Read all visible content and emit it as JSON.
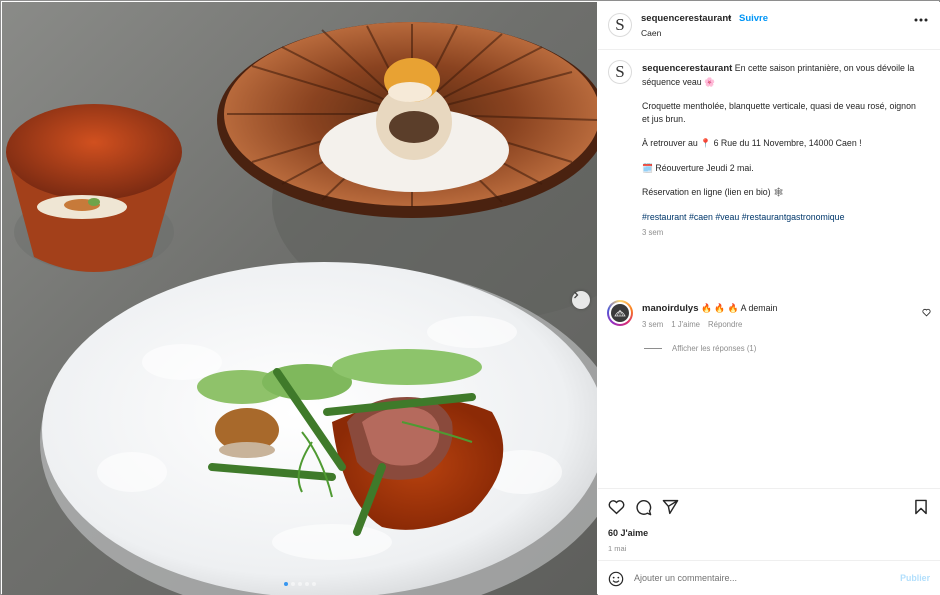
{
  "post": {
    "username": "sequencerestaurant",
    "separator": "•",
    "follow_label": "Suivre",
    "location": "Caen",
    "avatar_letter": "S"
  },
  "caption": {
    "username": "sequencerestaurant",
    "intro": "En cette saison printanière, on vous dévoile la séquence veau 🌸",
    "dishes": "Croquette mentholée, blanquette verticale, quasi de veau rosé, oignon et jus brun.",
    "address": "À retrouver au 📍 6 Rue du 11 Novembre, 14000 Caen !",
    "reopening": "🗓️ Réouverture Jeudi 2 mai.",
    "booking": "Réservation en ligne (lien en bio) 🕸",
    "hashtags": "#restaurant #caen #veau #restaurantgastronomique",
    "time": "3 sem"
  },
  "comment": {
    "username": "manoirdulys",
    "text": "🔥 🔥 🔥 A demain",
    "time": "3 sem",
    "like_label": "1 J'aime",
    "reply_label": "Répondre",
    "view_replies": "Afficher les réponses (1)"
  },
  "engagement": {
    "likes": "60 J'aime",
    "date": "1 mai"
  },
  "composer": {
    "placeholder": "Ajouter un commentaire...",
    "publish_label": "Publier"
  },
  "carousel": {
    "slide_count": 5,
    "active_index": 0
  },
  "colors": {
    "accent": "#0095f6",
    "hashtag": "#00376b",
    "meta_text": "#8e8e8e"
  }
}
